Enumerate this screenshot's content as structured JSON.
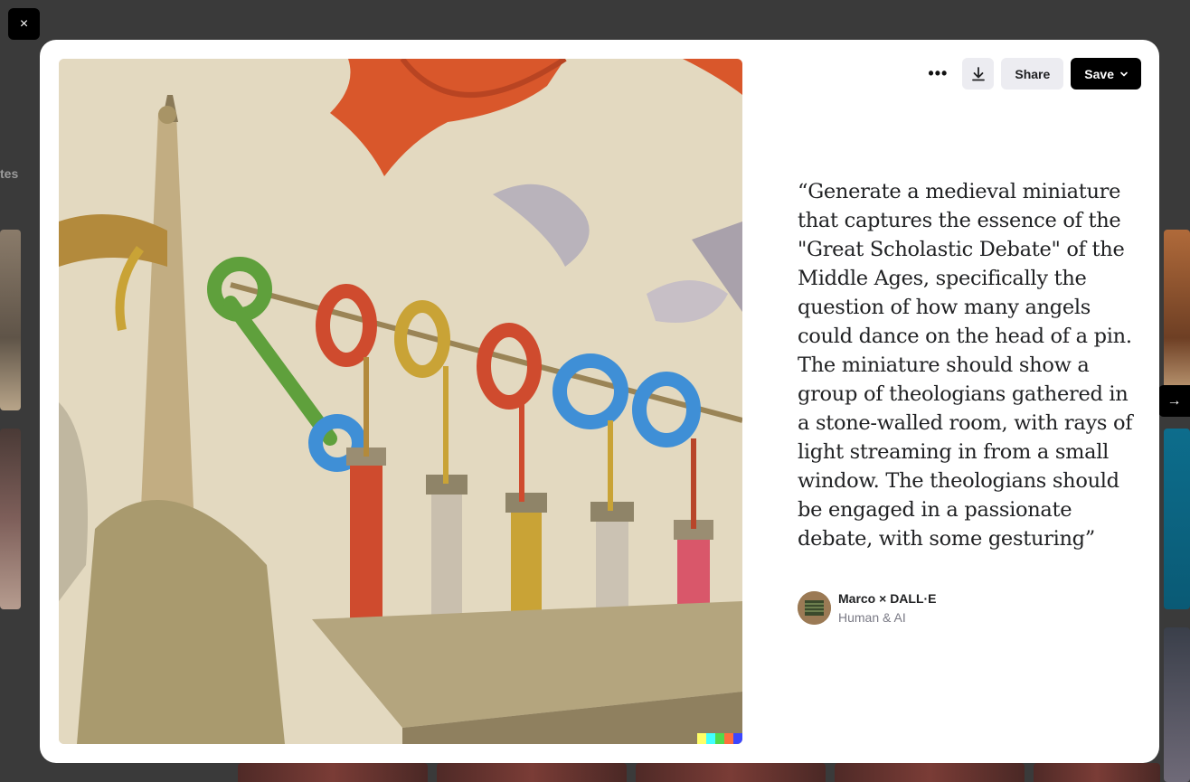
{
  "background": {
    "side_label": "tes"
  },
  "controls": {
    "close_glyph": "×",
    "next_glyph": "→"
  },
  "toolbar": {
    "more_label": "•••",
    "share_label": "Share",
    "save_label": "Save"
  },
  "prompt": {
    "text": "“Generate a medieval miniature that captures the essence of the \"Great Scholastic Debate\" of the Middle Ages, specifically the question of how many angels could dance on the head of a pin. The miniature should show a group of theologians gathered in a stone-walled room, with rays of light streaming in from a small window. The theologians should be engaged in a passionate debate, with some gesturing”"
  },
  "author": {
    "name": "Marco × DALL·E",
    "subtitle": "Human & AI"
  },
  "signature_colors": [
    "#ffff66",
    "#42ffff",
    "#51da4c",
    "#ff6e3c",
    "#3c46ff"
  ],
  "artwork": {
    "palette": {
      "parchment": "#e8dfcb",
      "orange": "#d9572b",
      "green": "#5fa03c",
      "red": "#cf4b2e",
      "yellow": "#c9a336",
      "blue": "#3f8fd6",
      "pink": "#d9576a"
    }
  }
}
